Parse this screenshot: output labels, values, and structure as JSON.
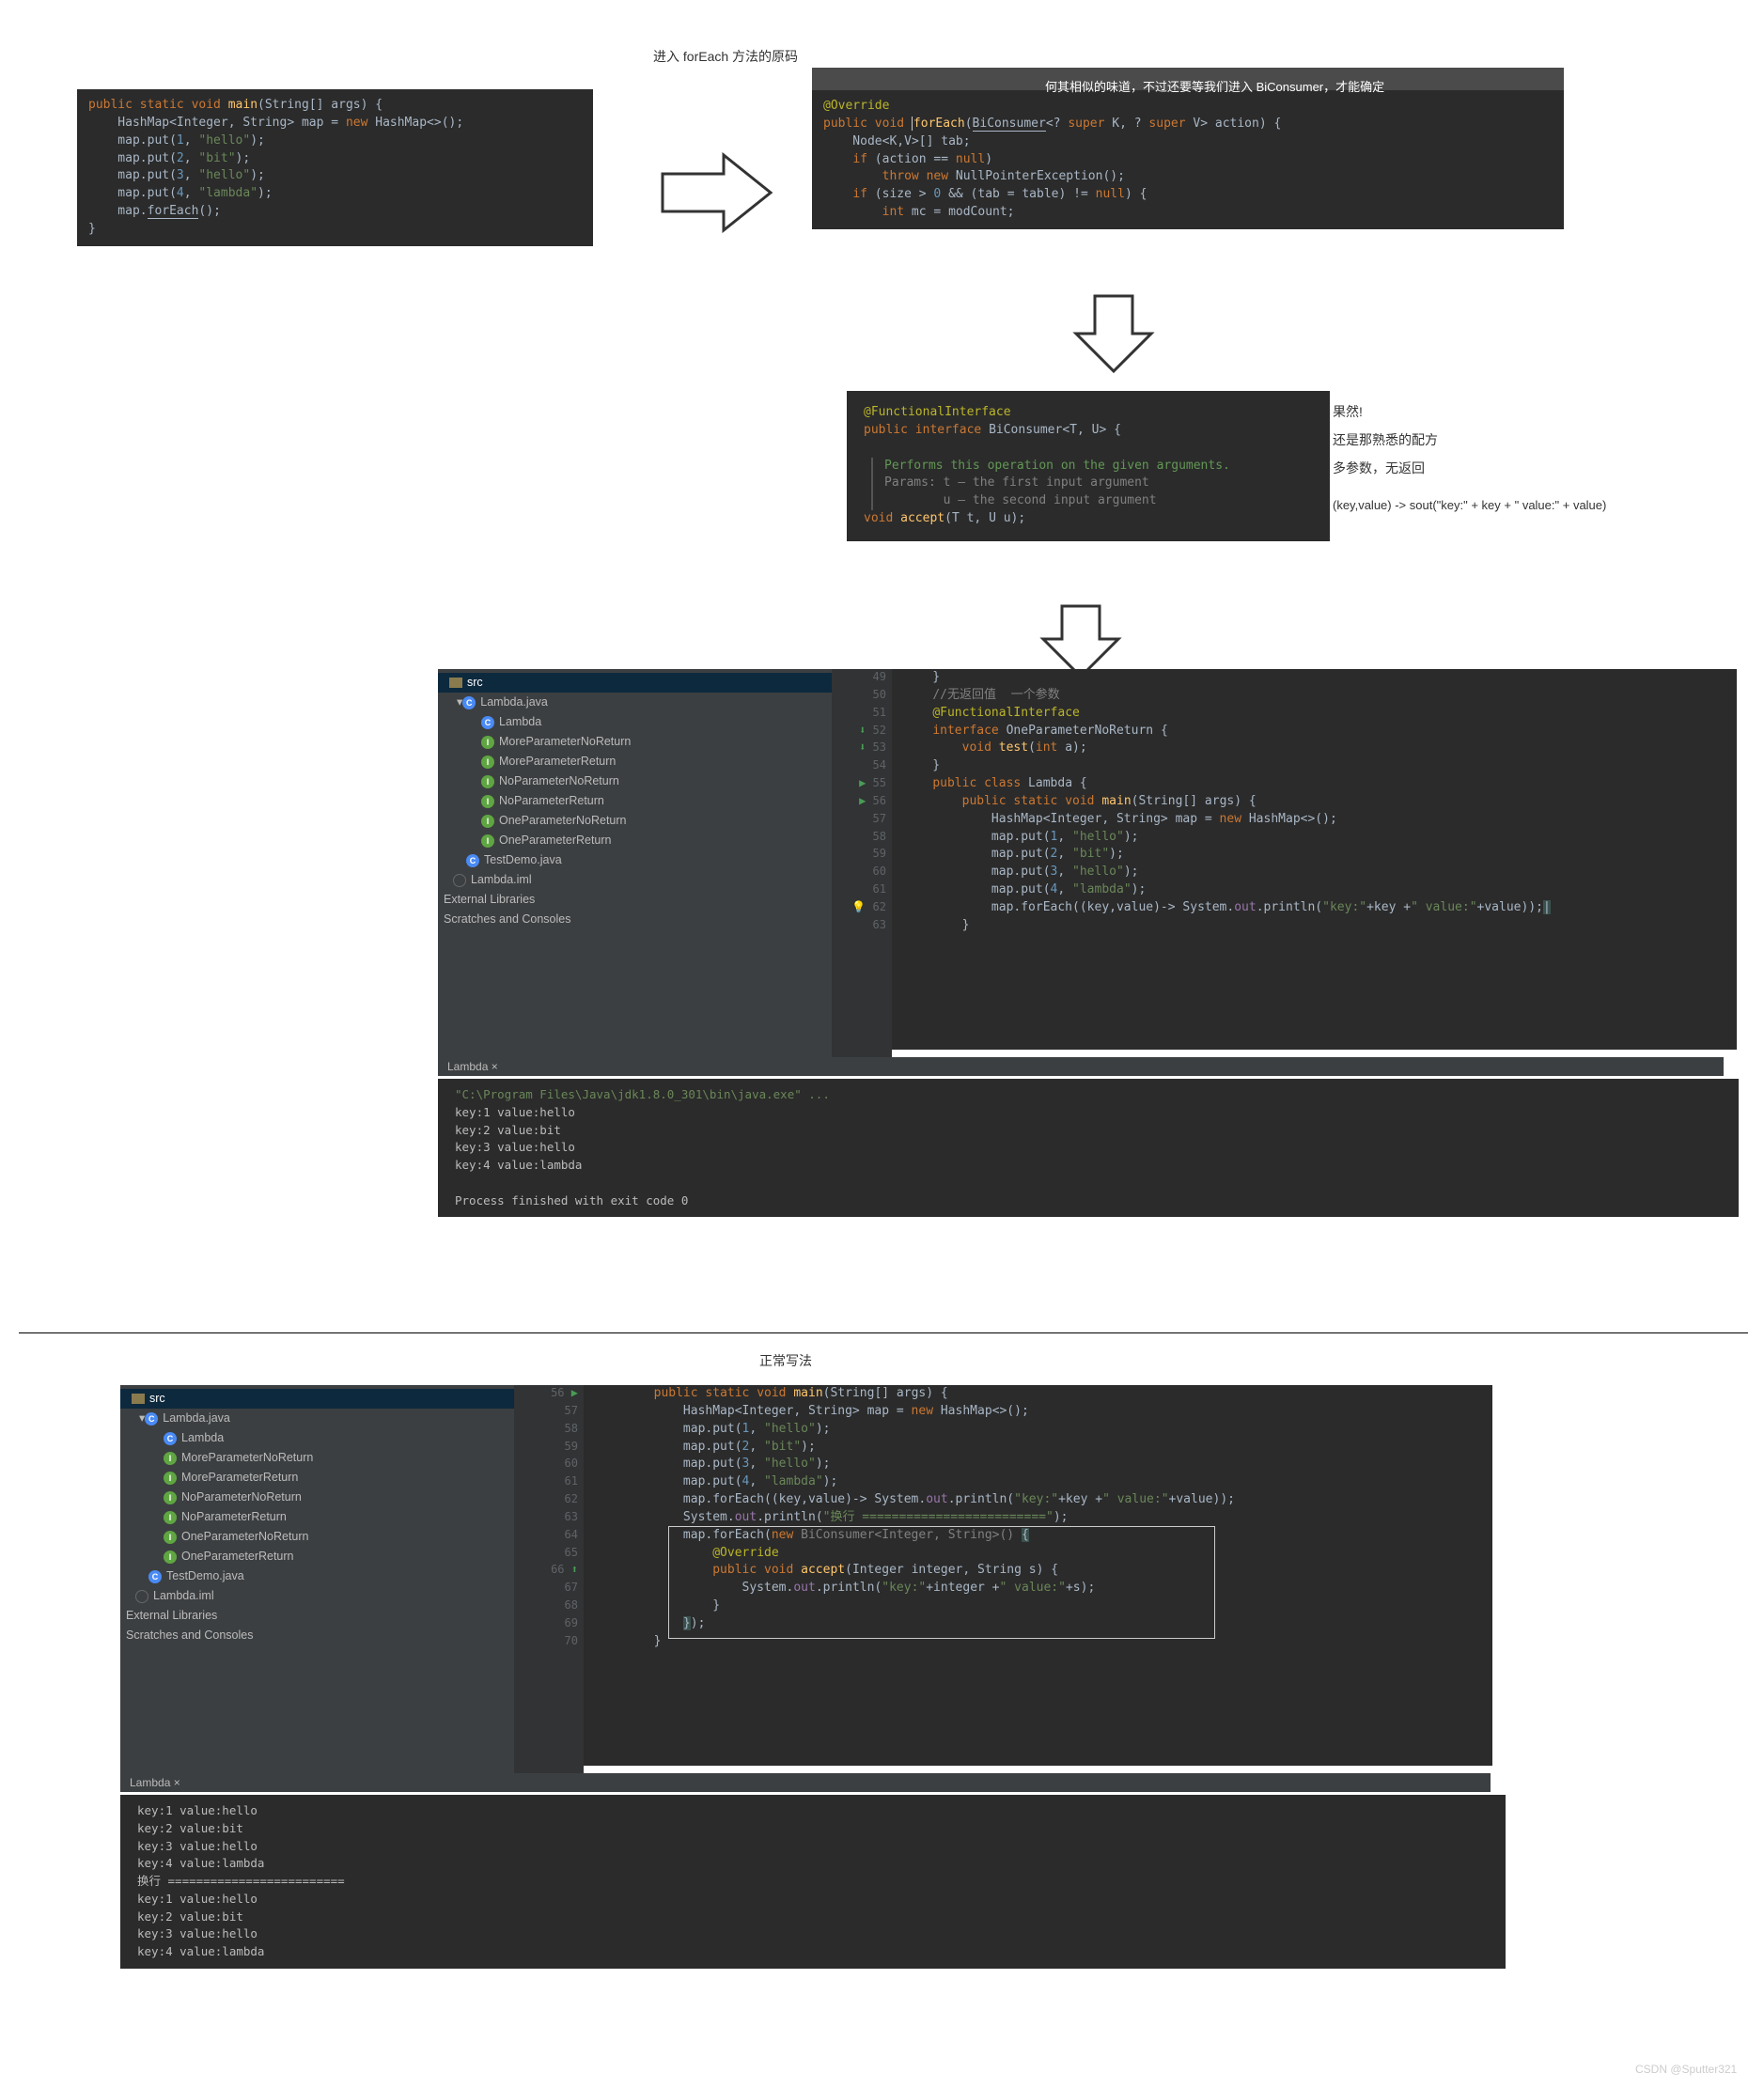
{
  "captions": {
    "title1": "进入 forEach 方法的原码",
    "title2": "何其相似的味道，不过还要等我们进入 BiConsumer，才能确定",
    "result_h": "果然!",
    "result_1": "还是那熟悉的配方",
    "result_2": "多参数，无返回",
    "result_lambda": "(key,value) -> sout(\"key:\" + key + \" value:\" + value)",
    "normal": "正常写法",
    "watermark": "CSDN @Sputter321"
  },
  "code1": [
    "public static void main(String[] args) {",
    "    HashMap<Integer, String> map = new HashMap<>();",
    "    map.put(1, \"hello\");",
    "    map.put(2, \"bit\");",
    "    map.put(3, \"hello\");",
    "    map.put(4, \"lambda\");",
    "    map.forEach();",
    "}"
  ],
  "code2": [
    "@Override",
    "public void forEach(BiConsumer<? super K, ? super V> action) {",
    "    Node<K,V>[] tab;",
    "    if (action == null)",
    "        throw new NullPointerException();",
    "    if (size > 0 && (tab = table) != null) {",
    "        int mc = modCount;"
  ],
  "code3": {
    "ann": "@FunctionalInterface",
    "decl": "public interface BiConsumer<T, U> {",
    "doc1": "Performs this operation on the given arguments.",
    "doc2": "Params: t – the first input argument",
    "doc3": "        u – the second input argument",
    "accept": "void accept(T t, U u);"
  },
  "tree": {
    "src": "src",
    "file1": "Lambda.java",
    "items": [
      "Lambda",
      "MoreParameterNoReturn",
      "MoreParameterReturn",
      "NoParameterNoReturn",
      "NoParameterReturn",
      "OneParameterNoReturn",
      "OneParameterReturn"
    ],
    "file2": "TestDemo.java",
    "iml": "Lambda.iml",
    "ext": "External Libraries",
    "scratch": "Scratches and Consoles"
  },
  "editor1": {
    "gutter": [
      "49",
      "50",
      "51",
      "52",
      "53",
      "54",
      "55",
      "56",
      "57",
      "58",
      "59",
      "60",
      "61",
      "62",
      "63"
    ],
    "lines": [
      "    }",
      "    //无返回值  一个参数",
      "    @FunctionalInterface",
      "    interface OneParameterNoReturn {",
      "        void test(int a);",
      "    }",
      "    public class Lambda {",
      "        public static void main(String[] args) {",
      "            HashMap<Integer, String> map = new HashMap<>();",
      "            map.put(1, \"hello\");",
      "            map.put(2, \"bit\");",
      "            map.put(3, \"hello\");",
      "            map.put(4, \"lambda\");",
      "            map.forEach((key,value)-> System.out.println(\"key:\"+key +\" value:\"+value));",
      "        }"
    ]
  },
  "console1": {
    "tab": "Lambda ×",
    "path": "\"C:\\Program Files\\Java\\jdk1.8.0_301\\bin\\java.exe\" ...",
    "out": [
      "key:1 value:hello",
      "key:2 value:bit",
      "key:3 value:hello",
      "key:4 value:lambda"
    ],
    "exit": "Process finished with exit code 0"
  },
  "editor2": {
    "gutter": [
      "56",
      "57",
      "58",
      "59",
      "60",
      "61",
      "62",
      "63",
      "64",
      "65",
      "66",
      "67",
      "68",
      "69",
      "70"
    ],
    "lines": [
      "        public static void main(String[] args) {",
      "            HashMap<Integer, String> map = new HashMap<>();",
      "            map.put(1, \"hello\");",
      "            map.put(2, \"bit\");",
      "            map.put(3, \"hello\");",
      "            map.put(4, \"lambda\");",
      "            map.forEach((key,value)-> System.out.println(\"key:\"+key +\" value:\"+value));",
      "            System.out.println(\"换行 =========================\");",
      "            map.forEach(new BiConsumer<Integer, String>() {",
      "                @Override",
      "                public void accept(Integer integer, String s) {",
      "                    System.out.println(\"key:\"+integer +\" value:\"+s);",
      "                }",
      "            });",
      "        }"
    ]
  },
  "console2": {
    "tab": "Lambda ×",
    "out": [
      "key:1 value:hello",
      "key:2 value:bit",
      "key:3 value:hello",
      "key:4 value:lambda",
      "换行 =========================",
      "key:1 value:hello",
      "key:2 value:bit",
      "key:3 value:hello",
      "key:4 value:lambda"
    ]
  }
}
